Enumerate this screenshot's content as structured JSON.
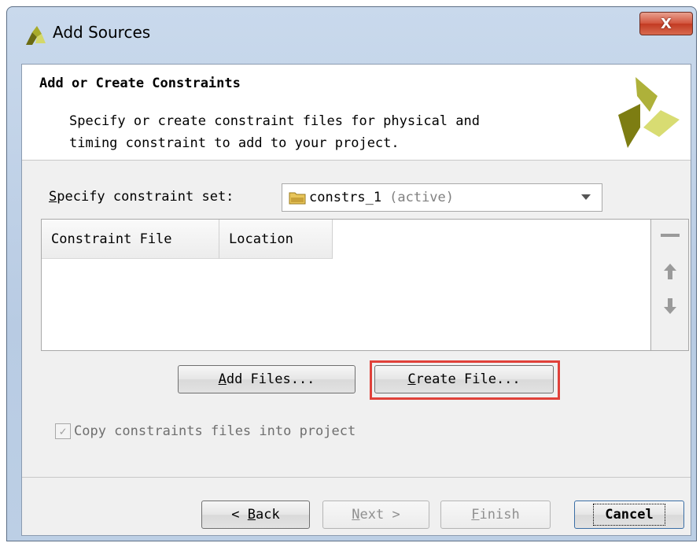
{
  "window": {
    "title": "Add Sources",
    "close_glyph": "X"
  },
  "header": {
    "title": "Add or Create Constraints",
    "description": "Specify or create constraint files for physical and\ntiming constraint to add to your project."
  },
  "constraint_set": {
    "label_mnemonic": "S",
    "label_rest": "pecify constraint set:",
    "selected_name": "constrs_1",
    "selected_status": "(active)"
  },
  "table": {
    "columns": [
      "Constraint File",
      "Location"
    ],
    "rows": []
  },
  "actions": {
    "add_files_mnemonic": "A",
    "add_files_rest": "dd Files...",
    "create_file_mnemonic": "C",
    "create_file_rest": "reate File..."
  },
  "copy_option": {
    "label": "Copy constraints files into project",
    "checked": true,
    "enabled": false
  },
  "footer": {
    "back_prefix": "< ",
    "back_mnemonic": "B",
    "back_rest": "ack",
    "next_mnemonic": "N",
    "next_rest": "ext >",
    "finish_mnemonic": "F",
    "finish_rest": "inish",
    "cancel_label": "Cancel"
  },
  "colors": {
    "highlight_frame": "#e0413a",
    "logo_dark": "#8a8a1a",
    "logo_light": "#cfd36a"
  },
  "icons": {
    "title": "xilinx-logo-icon",
    "close": "close-icon",
    "folder": "folder-icon",
    "dropdown": "chevron-down-icon",
    "remove": "minus-icon",
    "up": "arrow-up-icon",
    "down": "arrow-down-icon"
  }
}
